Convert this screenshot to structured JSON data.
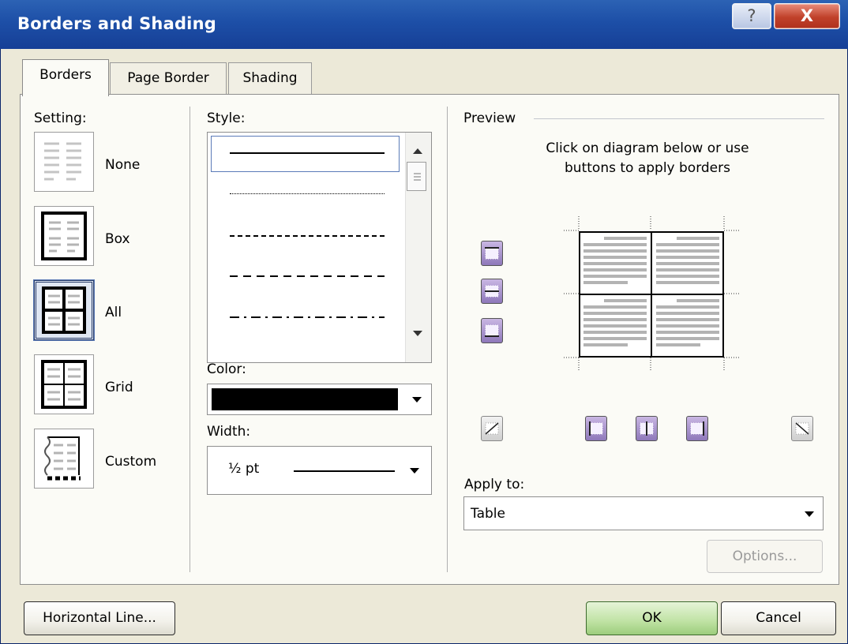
{
  "window": {
    "title": "Borders and Shading",
    "help_icon": "?",
    "close_icon": "X"
  },
  "tabs": [
    {
      "label": "Borders",
      "active": true
    },
    {
      "label": "Page Border",
      "active": false
    },
    {
      "label": "Shading",
      "active": false
    }
  ],
  "setting": {
    "heading": "Setting:",
    "options": [
      {
        "label": "None",
        "icon": "setting-none-icon",
        "selected": false
      },
      {
        "label": "Box",
        "icon": "setting-box-icon",
        "selected": false
      },
      {
        "label": "All",
        "icon": "setting-all-icon",
        "selected": true
      },
      {
        "label": "Grid",
        "icon": "setting-grid-icon",
        "selected": false
      },
      {
        "label": "Custom",
        "icon": "setting-custom-icon",
        "selected": false
      }
    ]
  },
  "style": {
    "heading": "Style:",
    "items": [
      "solid",
      "dotted",
      "dashed-short",
      "dashed-long",
      "dash-dot"
    ],
    "selected": "solid"
  },
  "color": {
    "heading": "Color:",
    "value": "#000000"
  },
  "width": {
    "heading": "Width:",
    "value": "½ pt"
  },
  "preview": {
    "heading": "Preview",
    "instructions_line1": "Click on diagram below or use",
    "instructions_line2": "buttons to apply borders"
  },
  "apply_to": {
    "heading": "Apply to:",
    "value": "Table"
  },
  "buttons": {
    "options": "Options...",
    "horizontal_line": "Horizontal Line...",
    "ok": "OK",
    "cancel": "Cancel"
  },
  "colors": {
    "titlebar": "#1d4fa7",
    "dialog_bg": "#ece9d8",
    "border_button_accent": "#8e78ba",
    "ok_button": "#bfe2a3"
  }
}
